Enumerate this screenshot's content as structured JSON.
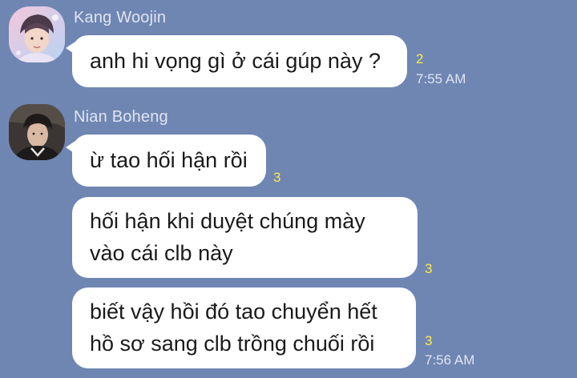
{
  "conversation": {
    "group1": {
      "sender": "Kang Woojin",
      "avatar_icon": "profile-photo-kang-woojin",
      "messages": [
        {
          "text": [
            "anh hi vọng gì ở cái gúp này ?"
          ],
          "unread": "2",
          "time": "7:55 AM"
        }
      ]
    },
    "group2": {
      "sender": "Nian Boheng",
      "avatar_icon": "profile-photo-nian-boheng",
      "messages": [
        {
          "text": [
            "ừ tao hối hận rồi"
          ],
          "unread": "3",
          "time": ""
        },
        {
          "text": [
            "hối hận khi duyệt chúng mày",
            "vào cái clb này"
          ],
          "unread": "3",
          "time": ""
        },
        {
          "text": [
            "biết vậy hồi đó tao chuyển hết",
            "hồ sơ sang clb trồng chuối rồi"
          ],
          "unread": "3",
          "time": "7:56 AM"
        }
      ]
    }
  },
  "colors": {
    "background": "#6f86b3",
    "bubble": "#ffffff",
    "unread_count": "#ffe94a",
    "meta_text": "#dfe5f1"
  }
}
